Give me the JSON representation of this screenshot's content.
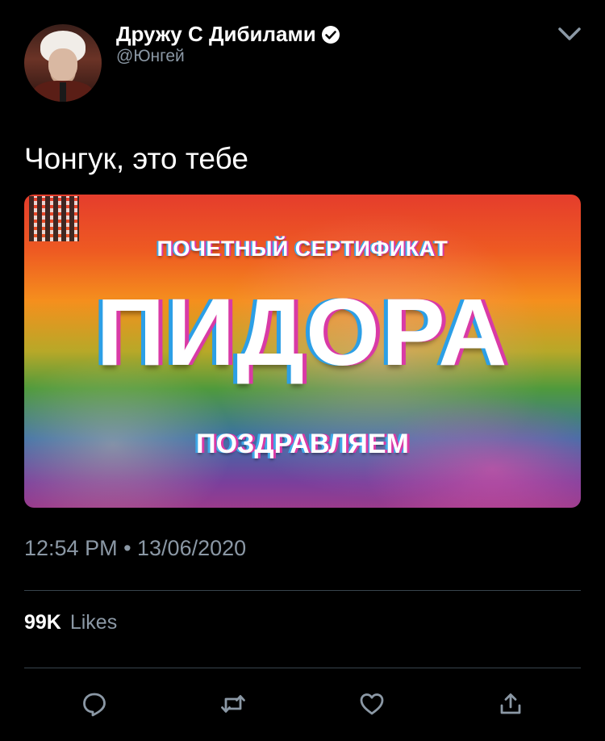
{
  "author": {
    "name": "Дружу С Дибилами",
    "handle": "@Юнгей",
    "verified": true
  },
  "tweet": {
    "text": "Чонгук, это тебе",
    "timestamp": "12:54 PM • 13/06/2020"
  },
  "media": {
    "line_top": "ПОЧЕТНЫЙ СЕРТИФИКАТ",
    "line_big": "ПИДОРА",
    "line_bottom": "ПОЗДРАВЛЯЕМ"
  },
  "stats": {
    "likes_count": "99K",
    "likes_label": "Likes"
  },
  "actions": {
    "reply_icon": "reply-icon",
    "retweet_icon": "retweet-icon",
    "like_icon": "like-icon",
    "share_icon": "share-icon"
  },
  "colors": {
    "background": "#000000",
    "secondary_text": "#8b98a5",
    "divider": "#38444d"
  }
}
